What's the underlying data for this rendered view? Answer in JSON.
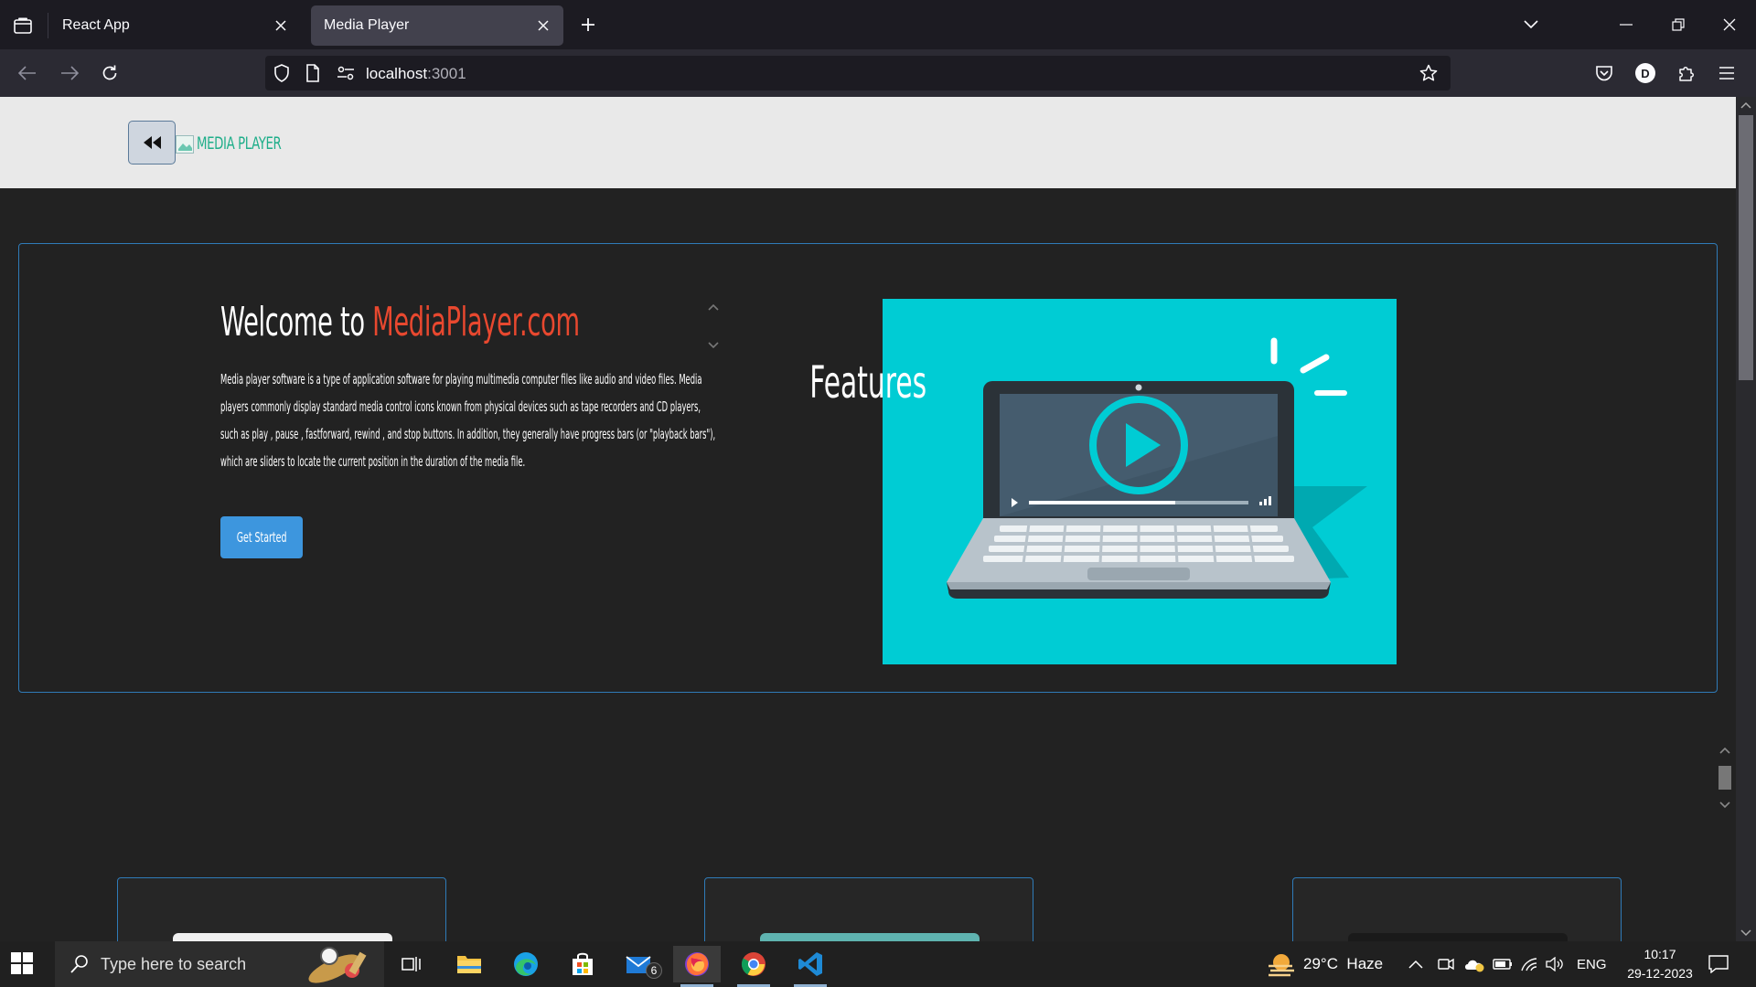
{
  "browser": {
    "tabs": [
      {
        "label": "React App",
        "active": false
      },
      {
        "label": "Media Player",
        "active": true
      }
    ],
    "url_host": "localhost",
    "url_port": ":3001",
    "profile_initial": "D"
  },
  "site": {
    "brand": "MEDIA PLAYER",
    "hero": {
      "title_prefix": "Welcome to ",
      "title_accent": "MediaPlayer.com",
      "description": "Media player software is a type of application software for playing multimedia computer files like audio and video files. Media players commonly display standard media control icons known from physical devices such as tape recorders and CD players, such as play , pause , fastforward, rewind , and stop buttons. In addition, they generally have progress bars (or \"playback bars\"), which are sliders to locate the current position in the duration of the media file.",
      "cta_label": "Get Started"
    },
    "features_title": "Features"
  },
  "taskbar": {
    "search_placeholder": "Type here to search",
    "mail_badge": "6",
    "weather": "29°C  Haze",
    "language": "ENG",
    "time": "10:17",
    "date": "29-12-2023"
  },
  "colors": {
    "accent_red": "#e8482f",
    "brand_green": "#1fae8a",
    "cta_blue": "#3d96de",
    "illustration_bg": "#00ccd4",
    "border_blue": "#2f7bb8"
  }
}
